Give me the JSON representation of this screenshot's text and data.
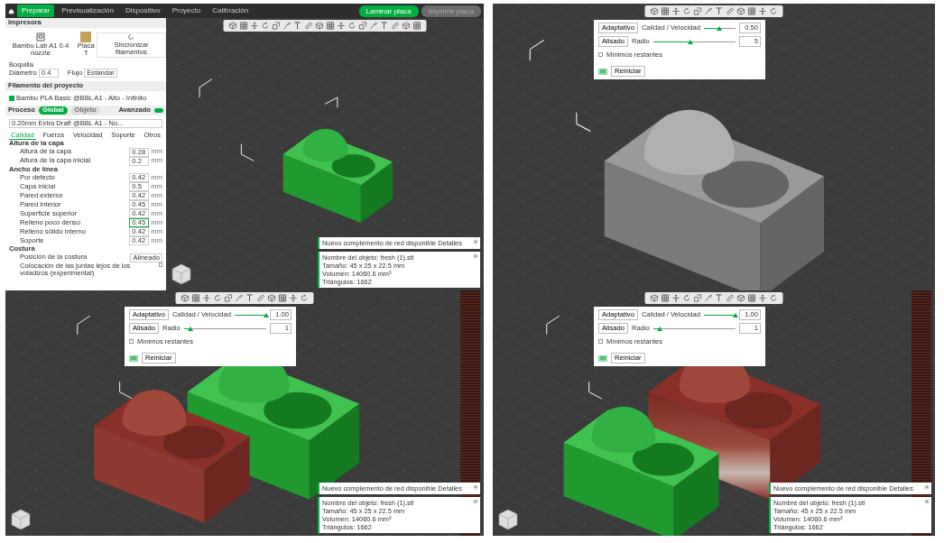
{
  "top_bar": {
    "tabs": [
      {
        "label": "Preparar",
        "selected": true
      },
      {
        "label": "Previsualización",
        "selected": false
      },
      {
        "label": "Dispositivo",
        "selected": false
      },
      {
        "label": "Proyecto",
        "selected": false
      },
      {
        "label": "Calibración",
        "selected": false
      }
    ],
    "slice_button": "Laminar placa",
    "print_button": {
      "label": "Imprimir placa",
      "disabled": true
    }
  },
  "sidebar": {
    "printer_title": "Impresora",
    "printer": "Bambu Lab A1 0.4 nozzle",
    "plate": "Placa T",
    "sync": "Sincronizar filamentos",
    "nozzle_label": "Boquilla",
    "diameter_label": "Diámetro",
    "diameter": "0.4",
    "flow_label": "Flujo",
    "flow": "Estándar",
    "filament_title": "Filamento del proyecto",
    "filament": "Bambu PLA Basic @BBL A1 - Alto - Infinito",
    "process_title": "Proceso",
    "scope": [
      {
        "label": "Global",
        "selected": true
      },
      {
        "label": "Objeto",
        "selected": false
      }
    ],
    "advanced_label": "Avanzado",
    "advanced": true,
    "preset": "0.20mm Extra Draft @BBL A1 - No...",
    "tabs": [
      {
        "label": "Calidad",
        "selected": true
      },
      {
        "label": "Fuerza",
        "selected": false
      },
      {
        "label": "Velocidad",
        "selected": false
      },
      {
        "label": "Soporte",
        "selected": false
      },
      {
        "label": "Otros",
        "selected": false
      }
    ],
    "sections": [
      {
        "title": "Altura de la capa",
        "rows": [
          {
            "kind": "value",
            "label": "Altura de la capa",
            "value": "0.28",
            "unit": "mm",
            "focused": false
          },
          {
            "kind": "value",
            "label": "Altura de la capa inicial",
            "value": "0.2",
            "unit": "mm",
            "focused": false
          }
        ]
      },
      {
        "title": "Ancho de línea",
        "rows": [
          {
            "kind": "value",
            "label": "Por defecto",
            "value": "0.42",
            "unit": "mm",
            "focused": false
          },
          {
            "kind": "value",
            "label": "Capa inicial",
            "value": "0.5",
            "unit": "mm",
            "focused": false
          },
          {
            "kind": "value",
            "label": "Pared exterior",
            "value": "0.42",
            "unit": "mm",
            "focused": false
          },
          {
            "kind": "value",
            "label": "Pared interior",
            "value": "0.45",
            "unit": "mm",
            "focused": false
          },
          {
            "kind": "value",
            "label": "Superficie superior",
            "value": "0.42",
            "unit": "mm",
            "focused": false
          },
          {
            "kind": "value",
            "label": "Relleno poco denso",
            "value": "0.45",
            "unit": "mm",
            "focused": true
          },
          {
            "kind": "value",
            "label": "Relleno sólido interno",
            "value": "0.42",
            "unit": "mm",
            "focused": false
          },
          {
            "kind": "value",
            "label": "Soporte",
            "value": "0.42",
            "unit": "mm",
            "focused": false
          }
        ]
      },
      {
        "title": "Costura",
        "rows": [
          {
            "kind": "select",
            "label": "Posición de la costura",
            "value": "Alineado"
          },
          {
            "kind": "check",
            "label": "Colocación de las juntas lejos de los voladizos (experimental)",
            "checked": false
          }
        ]
      }
    ]
  },
  "views": [
    {
      "kind": "single-green",
      "notifications": [
        {
          "kind": "plugin",
          "text": "Nuevo complemento de red disponible",
          "link": "Detalles"
        },
        {
          "kind": "info",
          "lines": [
            "Nombre del objeto: fresh (1).stl",
            "Tamaño: 45 x 25 x 22.5 mm",
            "Volumen: 14060.6 mm³",
            "Triángulos: 1662"
          ]
        }
      ]
    },
    {
      "kind": "single-grey",
      "popup": {
        "adaptive": "Adaptativo",
        "quality_label": "Calidad / Velocidad",
        "quality": {
          "level": 0.5
        },
        "quality_value": "0.50",
        "smooth": "Alisado",
        "radius_label": "Radio",
        "radius": {
          "level": 0.45
        },
        "radius_value": "5",
        "keep_min": {
          "label": "Mínimos restantes",
          "checked": false
        },
        "reset": "Reiniciar"
      }
    },
    {
      "kind": "pair-red-left",
      "popup": {
        "adaptive": "Adaptativo",
        "quality_label": "Calidad / Velocidad",
        "quality": {
          "level": 1.0
        },
        "quality_value": "1.00",
        "smooth": "Alisado",
        "radius_label": "Radio",
        "radius": {
          "level": 0.08
        },
        "radius_value": "1",
        "keep_min": {
          "label": "Mínimos restantes",
          "checked": false
        },
        "reset": "Reiniciar"
      },
      "notifications": [
        {
          "kind": "plugin",
          "text": "Nuevo complemento de red disponible",
          "link": "Detalles"
        },
        {
          "kind": "info",
          "lines": [
            "Nombre del objeto: fresh (1).stl",
            "Tamaño: 45 x 25 x 22.5 mm",
            "Volumen: 14060.6 mm³",
            "Triángulos: 1662"
          ]
        }
      ]
    },
    {
      "kind": "pair-red-right",
      "popup": {
        "adaptive": "Adaptativo",
        "quality_label": "Calidad / Velocidad",
        "quality": {
          "level": 1.0
        },
        "quality_value": "1.00",
        "smooth": "Alisado",
        "radius_label": "Radio",
        "radius": {
          "level": 0.08
        },
        "radius_value": "1",
        "keep_min": {
          "label": "Mínimos restantes",
          "checked": false
        },
        "reset": "Reiniciar"
      },
      "notifications": [
        {
          "kind": "plugin",
          "text": "Nuevo complemento de red disponible",
          "link": "Detalles"
        },
        {
          "kind": "info",
          "lines": [
            "Nombre del objeto: fresh (1).stl",
            "Tamaño: 45 x 25 x 22.5 mm",
            "Volumen: 14060.6 mm³",
            "Triángulos: 1662"
          ]
        }
      ]
    }
  ]
}
